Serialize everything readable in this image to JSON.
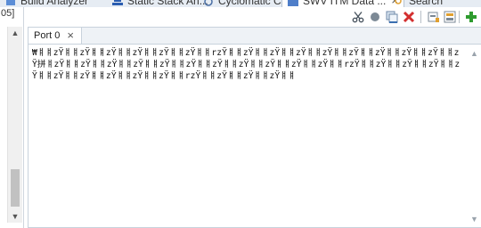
{
  "top_tabs": [
    {
      "label": "Build Analyzer",
      "active": false
    },
    {
      "label": "Static Stack An...",
      "active": false
    },
    {
      "label": "Cyclomatic Co...",
      "active": false
    },
    {
      "label": "SWV ITM Data ...",
      "active": true
    },
    {
      "label": "Search",
      "active": false
    }
  ],
  "left_panel": {
    "label": "05]"
  },
  "toolbar": {
    "icons": [
      "scissors-icon",
      "record-icon",
      "copy-icon",
      "clear-console-icon",
      "pin-icon",
      "display-icon",
      "new-console-icon"
    ],
    "colors": {
      "clear": "#d32f2f",
      "add": "#2e9b2e",
      "record": "#7d8a96"
    }
  },
  "console_view": {
    "tab_label": "Port 0",
    "close_glyph": "×",
    "output": "₩ㅒㅒzŸㅒㅒzŸㅒㅒzŸㅒㅒzŸㅒㅒzŸㅒㅒzŸㅒㅒrzŸㅒㅒzŸㅒㅒzŸㅒㅒzŸㅒㅒzŸㅒㅒzŸㅒㅒzŸㅒㅒzŸㅒㅒzŸㅒㅒzŸ拼ㅒzŸㅒㅒzŸㅒㅒzŸㅒㅒzŸㅒㅒzŸㅒㅒzŸㅒㅒzŸㅒㅒzŸㅒㅒzŸㅒㅒzŸㅒㅒzŸㅒㅒrzŸㅒㅒzŸㅒㅒzŸㅒㅒzŸㅒㅒzŸㅒㅒzŸㅒㅒzŸㅒㅒzŸㅒㅒzŸㅒㅒzŸㅒㅒrzŸㅒㅒzŸㅒㅒzŸㅒㅒzŸㅒㅒ"
  }
}
